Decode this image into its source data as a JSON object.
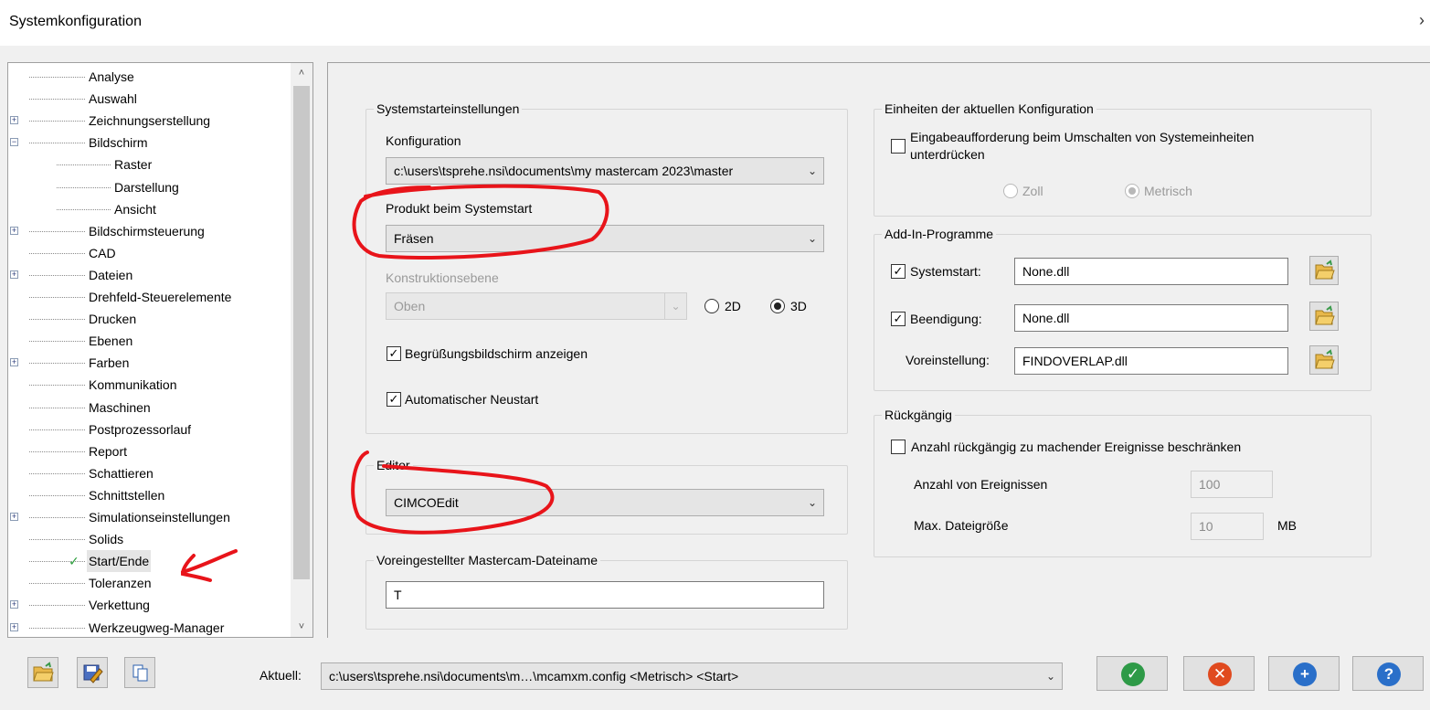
{
  "window": {
    "title": "Systemkonfiguration"
  },
  "tree": {
    "items": [
      {
        "label": "Analyse",
        "level": 0,
        "expandable": false
      },
      {
        "label": "Auswahl",
        "level": 0,
        "expandable": false
      },
      {
        "label": "Zeichnungserstellung",
        "level": 0,
        "expandable": true,
        "expanded": false
      },
      {
        "label": "Bildschirm",
        "level": 0,
        "expandable": true,
        "expanded": true
      },
      {
        "label": "Raster",
        "level": 1,
        "expandable": false
      },
      {
        "label": "Darstellung",
        "level": 1,
        "expandable": false
      },
      {
        "label": "Ansicht",
        "level": 1,
        "expandable": false
      },
      {
        "label": "Bildschirmsteuerung",
        "level": 0,
        "expandable": true,
        "expanded": false
      },
      {
        "label": "CAD",
        "level": 0,
        "expandable": false
      },
      {
        "label": "Dateien",
        "level": 0,
        "expandable": true,
        "expanded": false
      },
      {
        "label": "Drehfeld-Steuerelemente",
        "level": 0,
        "expandable": false
      },
      {
        "label": "Drucken",
        "level": 0,
        "expandable": false
      },
      {
        "label": "Ebenen",
        "level": 0,
        "expandable": false
      },
      {
        "label": "Farben",
        "level": 0,
        "expandable": true,
        "expanded": false
      },
      {
        "label": "Kommunikation",
        "level": 0,
        "expandable": false
      },
      {
        "label": "Maschinen",
        "level": 0,
        "expandable": false
      },
      {
        "label": "Postprozessorlauf",
        "level": 0,
        "expandable": false
      },
      {
        "label": "Report",
        "level": 0,
        "expandable": false
      },
      {
        "label": "Schattieren",
        "level": 0,
        "expandable": false
      },
      {
        "label": "Schnittstellen",
        "level": 0,
        "expandable": false
      },
      {
        "label": "Simulationseinstellungen",
        "level": 0,
        "expandable": true,
        "expanded": false
      },
      {
        "label": "Solids",
        "level": 0,
        "expandable": false
      },
      {
        "label": "Start/Ende",
        "level": 0,
        "expandable": false,
        "selected": true,
        "checked": true
      },
      {
        "label": "Toleranzen",
        "level": 0,
        "expandable": false
      },
      {
        "label": "Verkettung",
        "level": 0,
        "expandable": true,
        "expanded": false
      },
      {
        "label": "Werkzeugweg-Manager",
        "level": 0,
        "expandable": true,
        "expanded": false
      }
    ]
  },
  "startup": {
    "group_label": "Systemstarteinstellungen",
    "config_label": "Konfiguration",
    "config_value": "c:\\users\\tsprehe.nsi\\documents\\my mastercam 2023\\master",
    "product_label": "Produkt beim Systemstart",
    "product_value": "Fräsen",
    "plane_label": "Konstruktionsebene",
    "plane_value": "Oben",
    "radio_2d": "2D",
    "radio_3d": "3D",
    "splash_label": "Begrüßungsbildschirm anzeigen",
    "restart_label": "Automatischer Neustart"
  },
  "editor": {
    "group_label": "Editor",
    "value": "CIMCOEdit"
  },
  "filename": {
    "group_label": "Voreingestellter Mastercam-Dateiname",
    "value": "T"
  },
  "units": {
    "group_label": "Einheiten der aktuellen Konfiguration",
    "prompt_label_1": "Eingabeaufforderung beim Umschalten von Systemeinheiten",
    "prompt_label_2": "unterdrücken",
    "zoll": "Zoll",
    "metrisch": "Metrisch"
  },
  "addins": {
    "group_label": "Add-In-Programme",
    "startup_label": "Systemstart:",
    "startup_value": "None.dll",
    "exit_label": "Beendigung:",
    "exit_value": "None.dll",
    "default_label": "Voreinstellung:",
    "default_value": "FINDOVERLAP.dll"
  },
  "undo": {
    "group_label": "Rückgängig",
    "limit_label": "Anzahl rückgängig zu machender Ereignisse beschränken",
    "events_label": "Anzahl von Ereignissen",
    "events_value": "100",
    "size_label": "Max. Dateigröße",
    "size_value": "10",
    "size_unit": "MB"
  },
  "footer": {
    "current_label": "Aktuell:",
    "current_value": "c:\\users\\tsprehe.nsi\\documents\\m…\\mcamxm.config <Metrisch> <Start>"
  },
  "colors": {
    "ok": "#2e9a47",
    "cancel": "#e04a1f",
    "add": "#2a6fc9",
    "help": "#2a6fc9",
    "annotation": "#e8141a"
  }
}
